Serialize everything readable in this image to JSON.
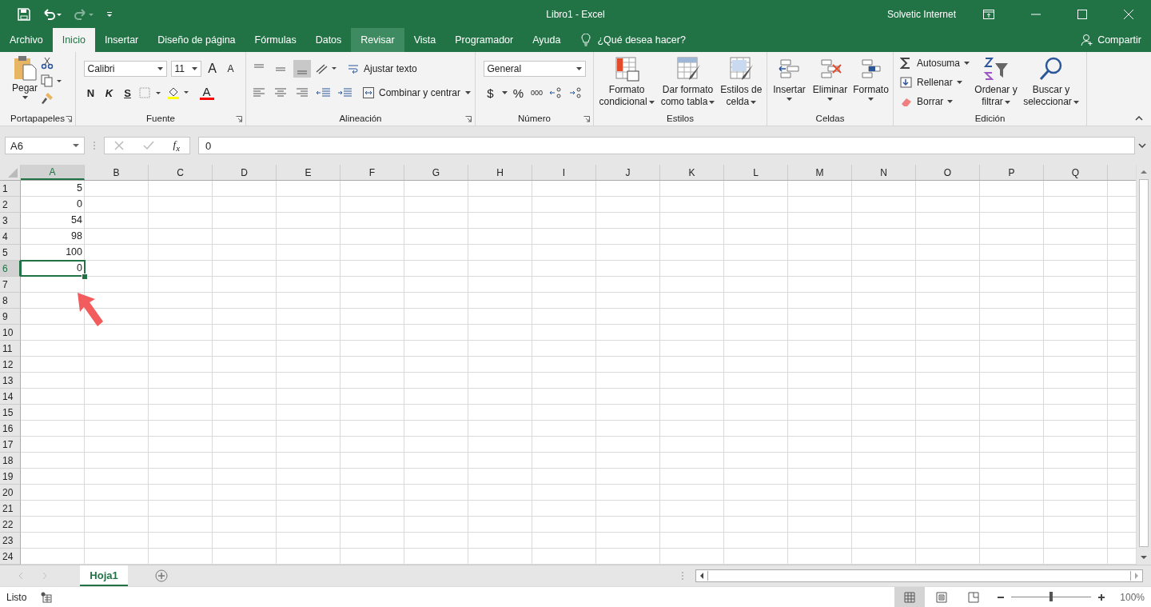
{
  "title_bar": {
    "title": "Libro1  -  Excel",
    "user": "Solvetic Internet"
  },
  "menu_tabs": [
    {
      "label": "Archivo",
      "selected": false,
      "hovered": false
    },
    {
      "label": "Inicio",
      "selected": true,
      "hovered": false
    },
    {
      "label": "Insertar",
      "selected": false,
      "hovered": false
    },
    {
      "label": "Diseño de página",
      "selected": false,
      "hovered": false
    },
    {
      "label": "Fórmulas",
      "selected": false,
      "hovered": false
    },
    {
      "label": "Datos",
      "selected": false,
      "hovered": false
    },
    {
      "label": "Revisar",
      "selected": false,
      "hovered": true
    },
    {
      "label": "Vista",
      "selected": false,
      "hovered": false
    },
    {
      "label": "Programador",
      "selected": false,
      "hovered": false
    },
    {
      "label": "Ayuda",
      "selected": false,
      "hovered": false
    }
  ],
  "tell_me": "¿Qué desea hacer?",
  "share": "Compartir",
  "ribbon_groups": [
    {
      "kind": "clipboard",
      "label": "Portapapeles",
      "paste": "Pegar"
    },
    {
      "kind": "font",
      "label": "Fuente",
      "font_name": "Calibri",
      "font_size": "11",
      "grow": "A",
      "shrink": "A",
      "bold": "N",
      "italic": "K",
      "underline": "S",
      "font_color": "A"
    },
    {
      "kind": "alignment",
      "label": "Alineación",
      "align_buttons": [
        {
          "kind": "top",
          "selected": false
        },
        {
          "kind": "middle",
          "selected": false
        },
        {
          "kind": "bottom",
          "selected": true
        }
      ],
      "wrap": "Ajustar texto",
      "merge": "Combinar y centrar"
    },
    {
      "kind": "number",
      "label": "Número",
      "format": "General",
      "currency": "$",
      "percent": "%",
      "thousands": "000"
    },
    {
      "kind": "styles",
      "label": "Estilos",
      "buttons": [
        "Formato condicional",
        "Dar formato como tabla",
        "Estilos de celda"
      ]
    },
    {
      "kind": "cells",
      "label": "Celdas",
      "buttons": [
        "Insertar",
        "Eliminar",
        "Formato"
      ]
    },
    {
      "kind": "editing",
      "label": "Edición",
      "small": [
        "Autosuma",
        "Rellenar",
        "Borrar"
      ],
      "large": [
        "Ordenar y filtrar",
        "Buscar y seleccionar"
      ]
    }
  ],
  "formula_bar": {
    "name_box": "A6",
    "function_label": "f$_{x}$",
    "value": "0"
  },
  "columns": [
    {
      "label": "A",
      "selected": true
    },
    {
      "label": "B",
      "selected": false
    },
    {
      "label": "C",
      "selected": false
    },
    {
      "label": "D",
      "selected": false
    },
    {
      "label": "E",
      "selected": false
    },
    {
      "label": "F",
      "selected": false
    },
    {
      "label": "G",
      "selected": false
    },
    {
      "label": "H",
      "selected": false
    },
    {
      "label": "I",
      "selected": false
    },
    {
      "label": "J",
      "selected": false
    },
    {
      "label": "K",
      "selected": false
    },
    {
      "label": "L",
      "selected": false
    },
    {
      "label": "M",
      "selected": false
    },
    {
      "label": "N",
      "selected": false
    },
    {
      "label": "O",
      "selected": false
    },
    {
      "label": "P",
      "selected": false
    },
    {
      "label": "Q",
      "selected": false
    }
  ],
  "rows": [
    {
      "label": "1",
      "selected": false,
      "values": [
        "5"
      ]
    },
    {
      "label": "2",
      "selected": false,
      "values": [
        "0"
      ]
    },
    {
      "label": "3",
      "selected": false,
      "values": [
        "54"
      ]
    },
    {
      "label": "4",
      "selected": false,
      "values": [
        "98"
      ]
    },
    {
      "label": "5",
      "selected": false,
      "values": [
        "100"
      ]
    },
    {
      "label": "6",
      "selected": true,
      "values": [
        "0"
      ]
    },
    {
      "label": "7",
      "selected": false
    },
    {
      "label": "8",
      "selected": false
    },
    {
      "label": "9",
      "selected": false
    },
    {
      "label": "10",
      "selected": false
    },
    {
      "label": "11",
      "selected": false
    },
    {
      "label": "12",
      "selected": false
    },
    {
      "label": "13",
      "selected": false
    },
    {
      "label": "14",
      "selected": false
    },
    {
      "label": "15",
      "selected": false
    },
    {
      "label": "16",
      "selected": false
    },
    {
      "label": "17",
      "selected": false
    },
    {
      "label": "18",
      "selected": false
    },
    {
      "label": "19",
      "selected": false
    },
    {
      "label": "20",
      "selected": false
    },
    {
      "label": "21",
      "selected": false
    },
    {
      "label": "22",
      "selected": false
    },
    {
      "label": "23",
      "selected": false
    },
    {
      "label": "24",
      "selected": false
    }
  ],
  "sheet_tabs": [
    {
      "label": "Hoja1",
      "selected": true
    }
  ],
  "status_bar": {
    "status": "Listo",
    "zoom": "100%",
    "zoom_level": {
      "level": 0.5
    }
  }
}
